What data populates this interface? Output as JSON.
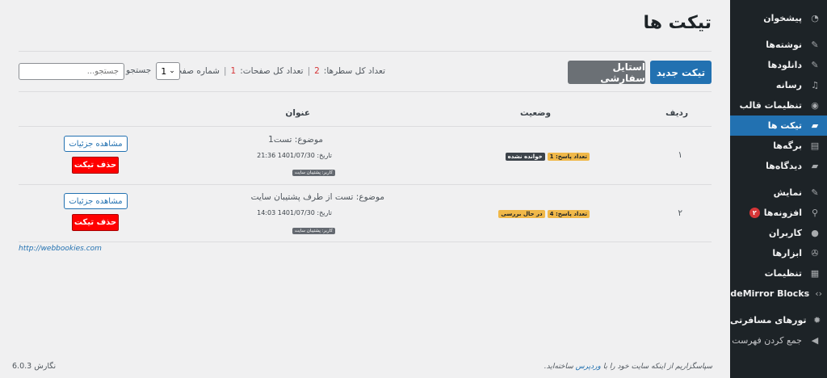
{
  "sidebar": {
    "items": [
      {
        "label": "پیشخوان",
        "icon": "dashboard-icon",
        "glyph": "◔"
      },
      {
        "label": "نوشته‌ها",
        "icon": "pin-icon",
        "glyph": "✎"
      },
      {
        "label": "دانلودها",
        "icon": "pin-icon",
        "glyph": "✎"
      },
      {
        "label": "رسانه",
        "icon": "media-icon",
        "glyph": "♫"
      },
      {
        "label": "تنظیمات قالب",
        "icon": "theme-icon",
        "glyph": "◉"
      },
      {
        "label": "تیکت ها",
        "icon": "comment-icon",
        "glyph": "▰"
      },
      {
        "label": "برگه‌ها",
        "icon": "page-icon",
        "glyph": "▤"
      },
      {
        "label": "دیدگاه‌ها",
        "icon": "comment-icon",
        "glyph": "▰"
      },
      {
        "label": "نمایش",
        "icon": "appearance-icon",
        "glyph": "✎"
      },
      {
        "label": "افزونه‌ها",
        "icon": "plugin-icon",
        "glyph": "⚲",
        "badge": "۲"
      },
      {
        "label": "کاربران",
        "icon": "user-icon",
        "glyph": "●"
      },
      {
        "label": "ابزارها",
        "icon": "wrench-icon",
        "glyph": "✇"
      },
      {
        "label": "تنظیمات",
        "icon": "settings-icon",
        "glyph": "▦"
      },
      {
        "label": "CodeMirror Blocks",
        "icon": "code-icon",
        "glyph": "‹›"
      },
      {
        "label": "تورهای مسافرتی",
        "icon": "gear-icon",
        "glyph": "✹"
      },
      {
        "label": "جمع کردن فهرست",
        "icon": "collapse-icon",
        "glyph": "◀"
      }
    ]
  },
  "header": {
    "title": "تیکت ها"
  },
  "toolbar": {
    "new_ticket": "تیکت جدید",
    "custom_style": "استایل سفارشی",
    "total_rows_label": "تعداد کل سطرها:",
    "total_rows_value": "2",
    "total_pages_label": "تعداد کل صفحات:",
    "total_pages_value": "1",
    "page_number_label": "شماره صفحه",
    "page_number_value": "1",
    "search_label": "جستجو",
    "search_placeholder": "جستجو..."
  },
  "table": {
    "headers": {
      "row": "ردیف",
      "status": "وضعیت",
      "title": "عنوان"
    },
    "rows": [
      {
        "num": "۱",
        "reply_count": "تعداد پاسخ: 1",
        "status": "خوانده نشده",
        "subject": "موضوع: تست1",
        "date": "تاریخ: 1401/07/30 21:36",
        "user": "کاربر: پشتیبان سایت",
        "view_label": "مشاهده جزئیات",
        "delete_label": "حذف تیکت"
      },
      {
        "num": "۲",
        "reply_count": "تعداد پاسخ: 4",
        "status": "در حال بررسی",
        "subject": "موضوع: تست از طرف پشتیبان سایت",
        "date": "تاریخ: 1401/07/30 14:03",
        "user": "کاربر: پشتیبان سایت",
        "view_label": "مشاهده جزئیات",
        "delete_label": "حذف تیکت"
      }
    ]
  },
  "site_link": "http://webbookies.com",
  "footer": {
    "thanks_pre": "سپاسگزاریم از اینکه سایت خود را با",
    "wordpress": "وردپرس",
    "thanks_post": "ساخته‌اید.",
    "version": "نگارش 6.0.3"
  },
  "colors": {
    "accent": "#2271b1",
    "sidebar": "#1d2327",
    "danger": "#ff0000",
    "badge": "#f0b849"
  }
}
